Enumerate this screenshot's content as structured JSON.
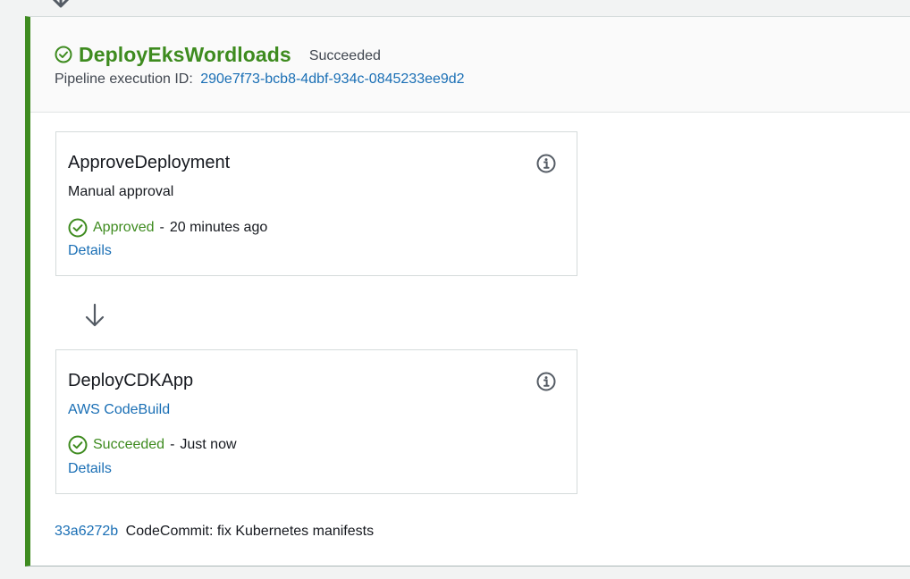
{
  "stage": {
    "name": "DeployEksWordloads",
    "status": "Succeeded",
    "execution_label": "Pipeline execution ID:",
    "execution_id": "290e7f73-bcb8-4dbf-934c-0845233ee9d2"
  },
  "actions": [
    {
      "name": "ApproveDeployment",
      "provider": "Manual approval",
      "status": "Approved",
      "separator": "-",
      "time": "20 minutes ago",
      "details_label": "Details"
    },
    {
      "name": "DeployCDKApp",
      "provider": "AWS CodeBuild",
      "status": "Succeeded",
      "separator": "-",
      "time": "Just now",
      "details_label": "Details"
    }
  ],
  "commit": {
    "id": "33a6272b",
    "message": "CodeCommit: fix Kubernetes manifests"
  },
  "colors": {
    "success": "#3e8b1f",
    "link": "#1a6fb5",
    "text": "#16191f",
    "muted": "#414750",
    "border": "#d5dbdb",
    "background": "#f2f3f3"
  },
  "icons": {
    "status": "check-circle-icon",
    "info": "info-icon",
    "transition": "arrow-down-icon"
  }
}
